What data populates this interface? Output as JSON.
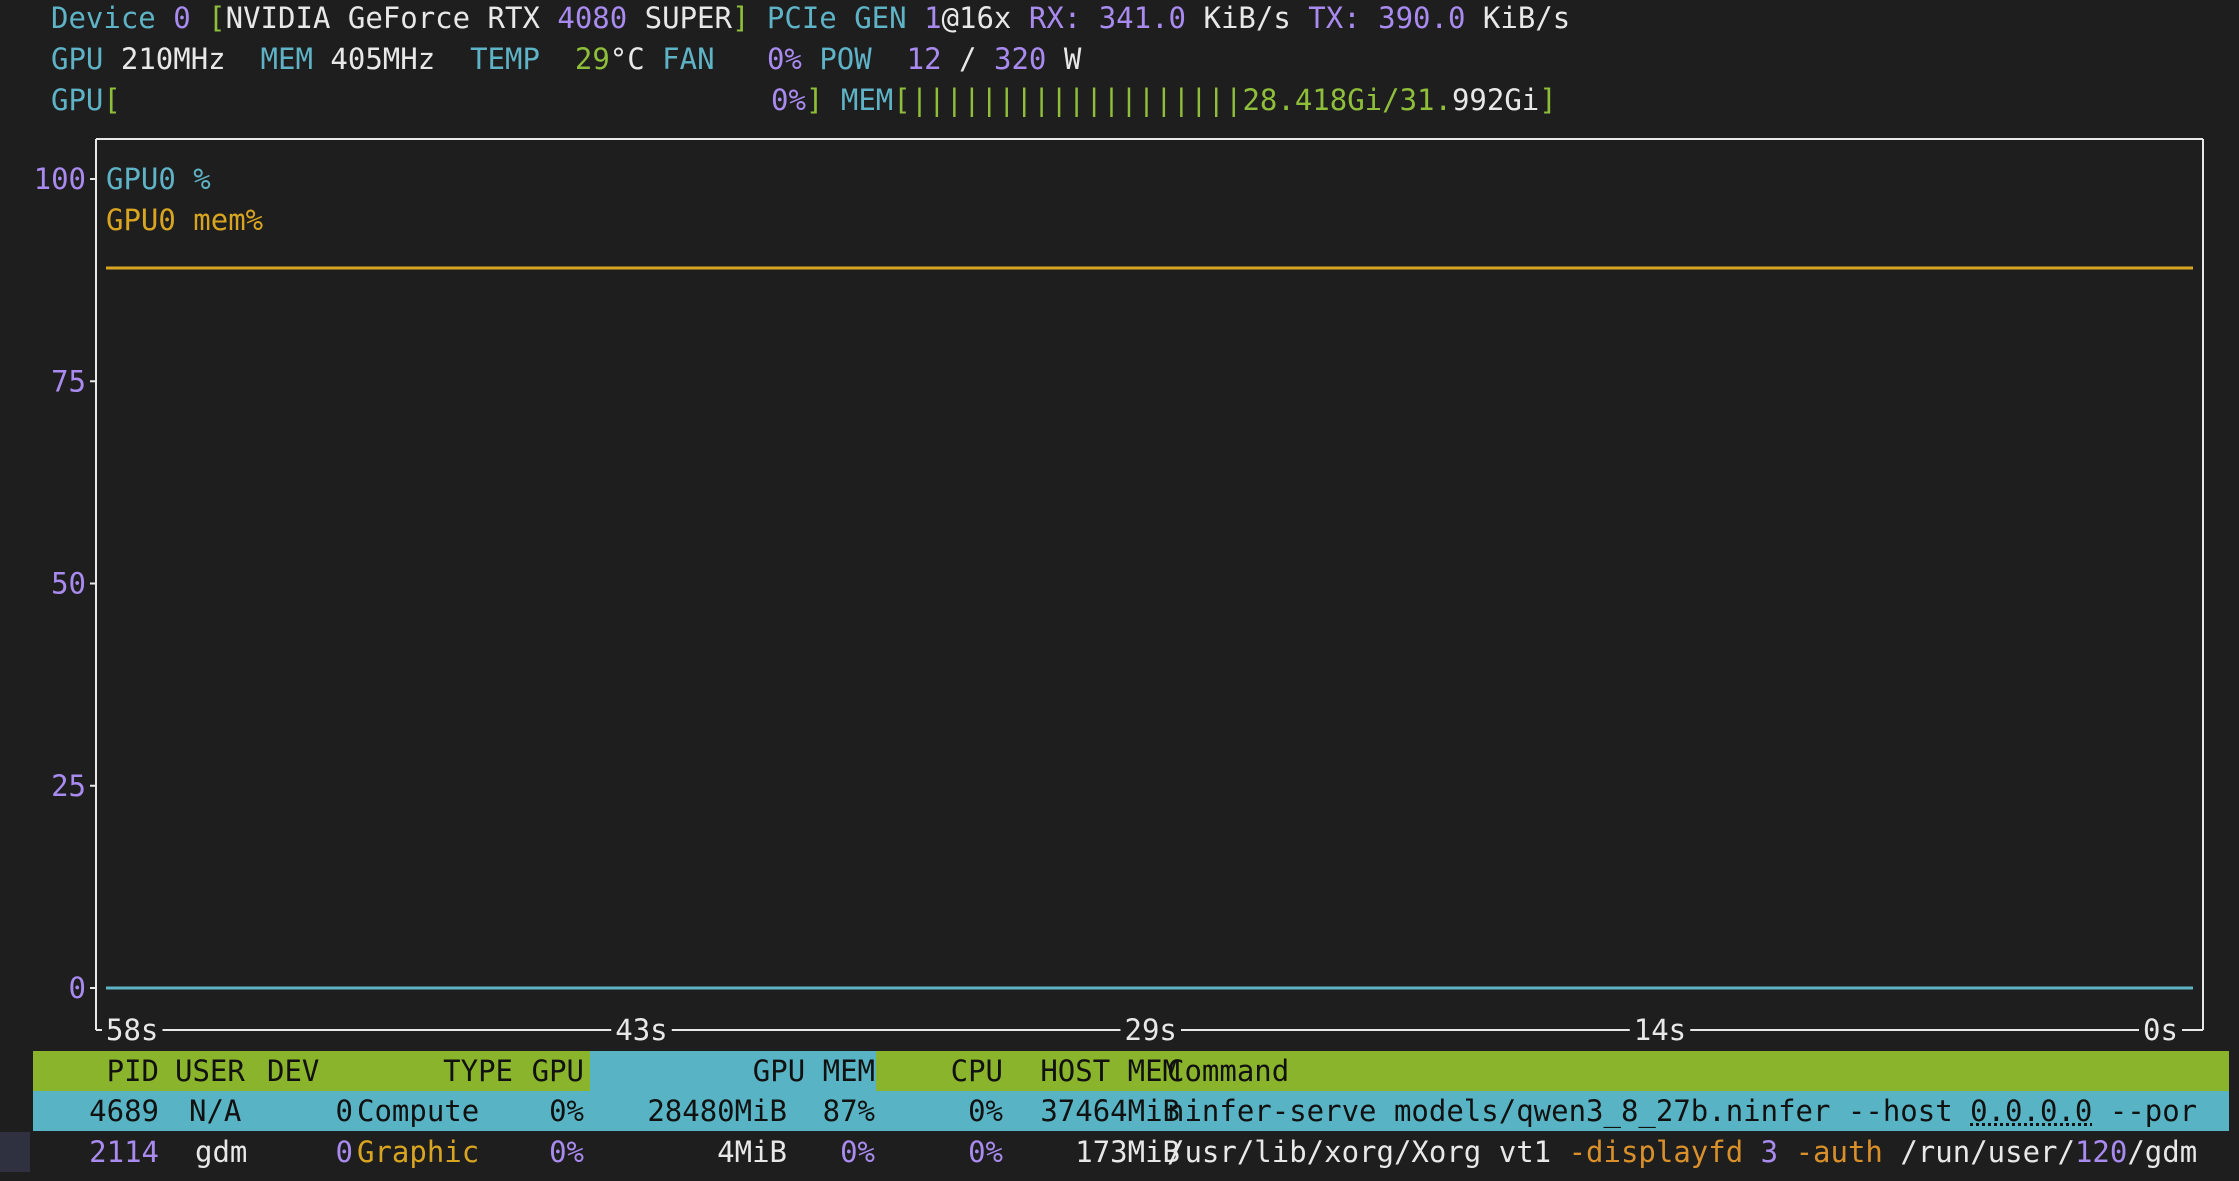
{
  "header": {
    "device_label": "Device",
    "device_index": "0",
    "open_bracket": "[",
    "device_name_pre": "NVIDIA GeForce RTX ",
    "device_model_num": "4080",
    "device_name_post": " SUPER",
    "close_bracket": "]",
    "pcie_label": "PCIe GEN",
    "pcie_gen": "1",
    "pcie_width": "@16x",
    "rx_label": "RX:",
    "rx_value": "341.0",
    "rx_unit": "KiB/s",
    "tx_label": "TX:",
    "tx_value": "390.0",
    "tx_unit": "KiB/s",
    "gpu_clock_label": "GPU",
    "gpu_clock": "210MHz",
    "mem_clock_label": "MEM",
    "mem_clock": "405MHz",
    "temp_label": "TEMP",
    "temp_value": "29",
    "temp_unit": "°C",
    "fan_label": "FAN",
    "fan_value": "0%",
    "pow_label": "POW",
    "pow_current": "12",
    "pow_sep": "/",
    "pow_max": "320",
    "pow_unit": "W",
    "gpu_bar_label": "GPU",
    "gpu_bar_value": "0%",
    "mem_bar_label": "MEM",
    "mem_bar_ticks": "|||||||||||||||||||",
    "mem_bar_used": "28.418Gi/31.",
    "mem_bar_total_rest": "992Gi",
    "gpu_util_fraction": 0.0,
    "mem_util_fraction": 0.89
  },
  "chart_data": {
    "type": "line",
    "title": "",
    "xlabel": "",
    "ylabel": "",
    "ylim": [
      0,
      100
    ],
    "y_ticks": [
      "100",
      "75",
      "50",
      "25",
      "0"
    ],
    "x_ticks": [
      "58s",
      "43s",
      "29s",
      "14s",
      "0s"
    ],
    "series": [
      {
        "name": "GPU0 %",
        "color": "#5fb3c7",
        "values": [
          0,
          0,
          0,
          0,
          0
        ]
      },
      {
        "name": "GPU0 mem%",
        "color": "#d9a521",
        "values": [
          89,
          89,
          89,
          89,
          89
        ]
      }
    ]
  },
  "table": {
    "headers": {
      "pid": "PID",
      "user": "USER",
      "dev": "DEV",
      "type": "TYPE",
      "gpu": "GPU",
      "gpu_mem": "GPU MEM",
      "cpu": "CPU",
      "host_mem": "HOST MEM",
      "command": "Command"
    },
    "rows": [
      {
        "pid": "4689",
        "user": "N/A",
        "dev": "0",
        "type": "Compute",
        "gpu": "0%",
        "gpu_mem": "28480MiB",
        "gpu_mem_pct": "87%",
        "cpu": "0%",
        "host_mem": "37464MiB",
        "command_pre": "ninfer-serve models/qwen3_8_27b.ninfer --host ",
        "command_host": "0.0.0.0",
        "command_post": " --por"
      },
      {
        "pid": "2114",
        "user": "gdm",
        "dev": "0",
        "type": "Graphic",
        "gpu": "0%",
        "gpu_mem": "4MiB",
        "gpu_mem_pct": "0%",
        "cpu": "0%",
        "host_mem": "173MiB",
        "command_a": "/usr/lib/xorg/Xorg vt1 ",
        "command_b": "-displayfd",
        "command_c": " 3 ",
        "command_d": "-auth",
        "command_e": " /run/user/",
        "command_f": "120",
        "command_g": "/gdm"
      }
    ]
  }
}
